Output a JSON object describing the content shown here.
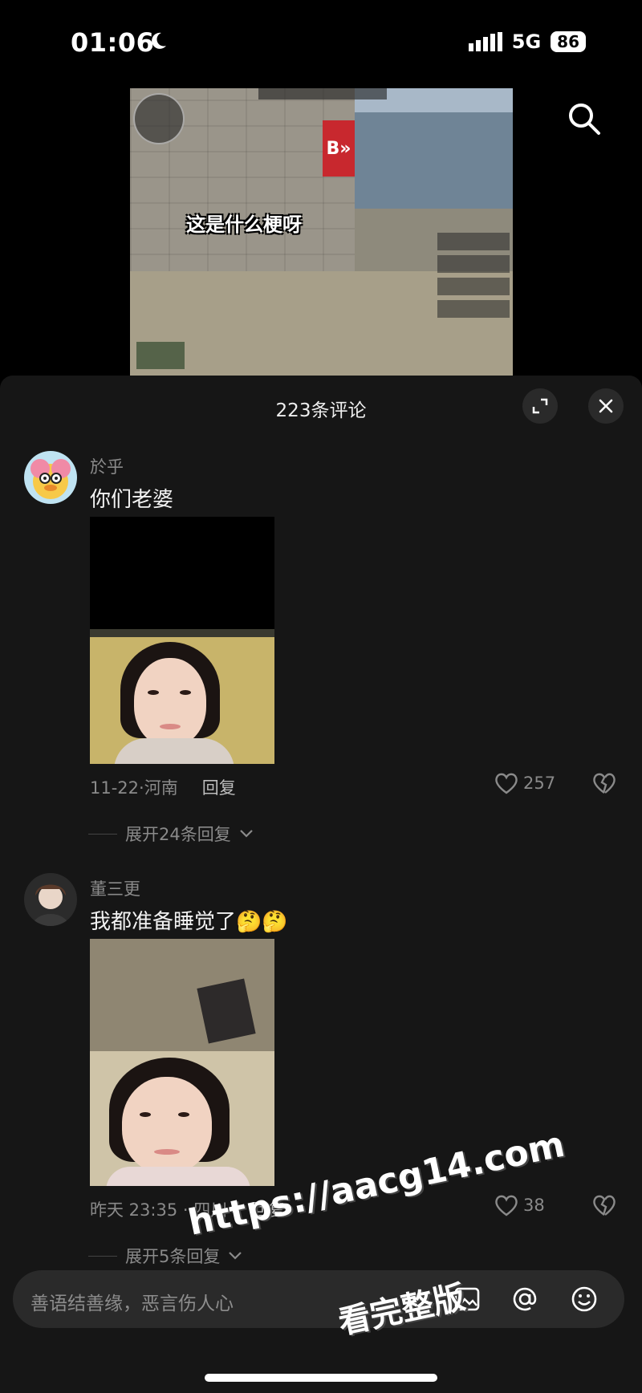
{
  "status_bar": {
    "time": "01:06",
    "network": "5G",
    "battery": "86"
  },
  "video": {
    "caption": "这是什么梗呀",
    "sign_text": "B»"
  },
  "sheet": {
    "title": "223条评论"
  },
  "comments": [
    {
      "user": "於乎",
      "text": "你们老婆",
      "date_location": "11-22·河南",
      "reply_label": "回复",
      "likes": "257",
      "expand_label": "展开24条回复"
    },
    {
      "user": "董三更",
      "text": "我都准备睡觉了🤔🤔",
      "date_location": "昨天 23:35 · 四川",
      "reply_label": "回复",
      "likes": "38",
      "expand_label": "展开5条回复"
    }
  ],
  "input": {
    "placeholder": "善语结善缘，恶言伤人心"
  },
  "watermark": {
    "line1": "https://aacg14.com",
    "line2": "看完整版"
  },
  "colors": {
    "sheet_bg": "#161616",
    "accent": "#ffffff",
    "muted": "#8a8a8a"
  }
}
